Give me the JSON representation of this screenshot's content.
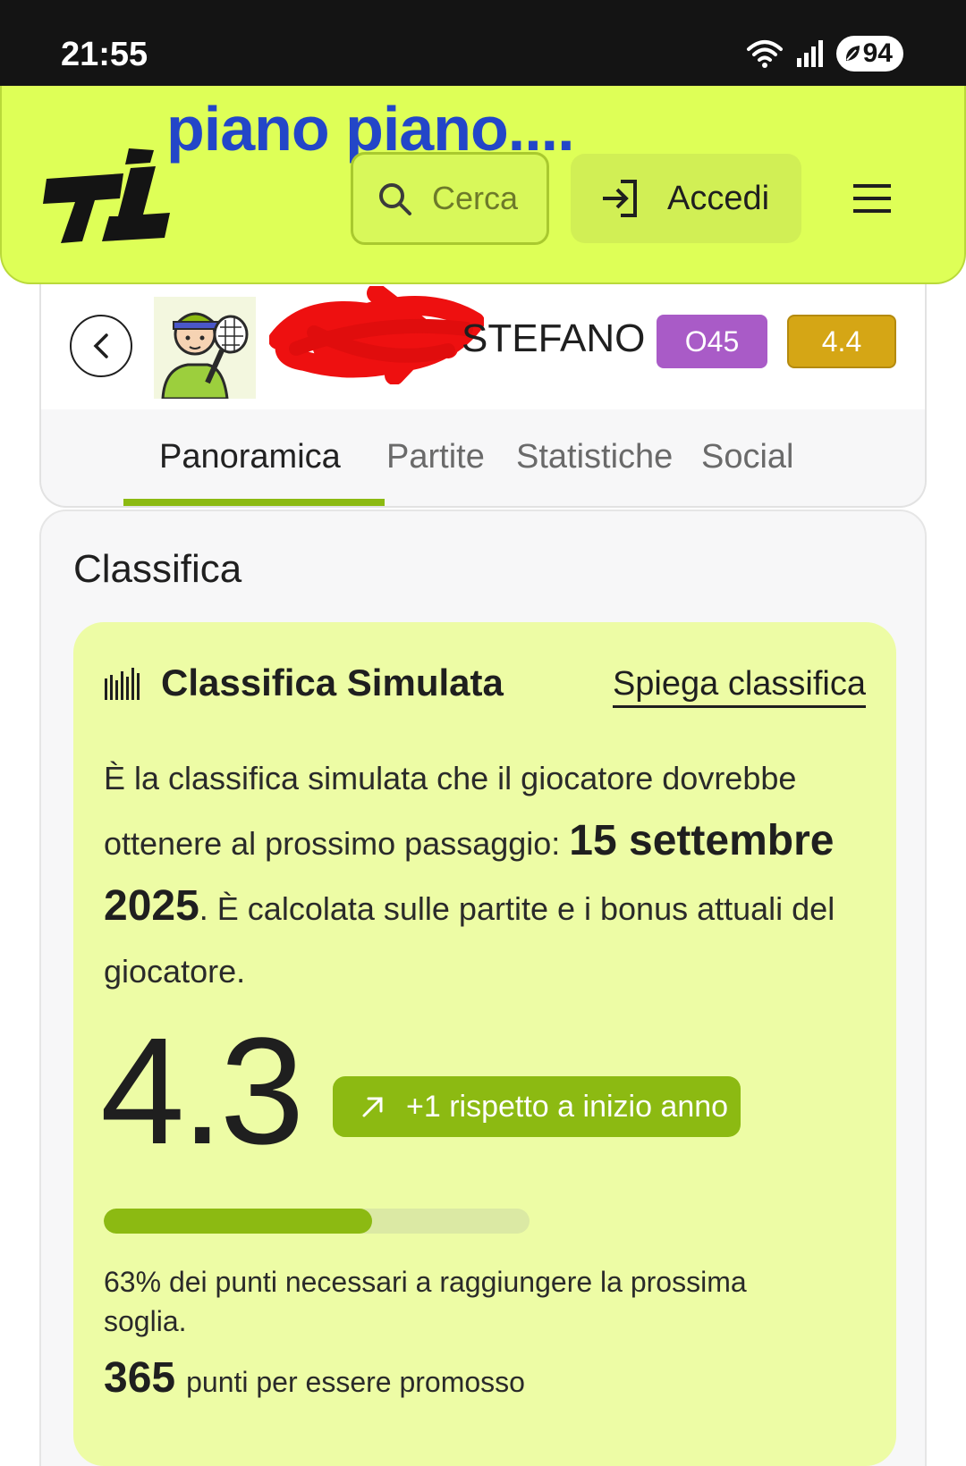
{
  "status_bar": {
    "time": "21:55",
    "battery": "94",
    "icons": [
      "wifi-icon",
      "signal-icon",
      "battery-icon"
    ]
  },
  "annotation": "piano piano....",
  "header": {
    "logo": "TI",
    "search_placeholder": "Cerca",
    "login_label": "Accedi",
    "icons": [
      "search-icon",
      "login-icon",
      "menu-icon"
    ]
  },
  "profile": {
    "name": "STEFANO",
    "category_badge": "O45",
    "ranking_badge": "4.4",
    "tabs": [
      {
        "label": "Panoramica",
        "active": true
      },
      {
        "label": "Partite",
        "active": false
      },
      {
        "label": "Statistiche",
        "active": false
      },
      {
        "label": "Social",
        "active": false
      }
    ]
  },
  "section_title": "Classifica",
  "simulated": {
    "title": "Classifica Simulata",
    "explain_link": "Spiega classifica",
    "desc_before": "È la classifica simulata che il giocatore dovrebbe ottenere al prossimo passaggio: ",
    "desc_date": "15 settembre 2025",
    "desc_after": ". È calcolata sulle partite e i bonus attuali del giocatore.",
    "score": "4.3",
    "delta": "+1 rispetto a inizio anno",
    "progress_fraction": 0.63,
    "progress_text": "63% dei punti necessari a raggiungere la prossima soglia.",
    "points_number": "365",
    "points_text": "punti per essere promosso"
  },
  "colors": {
    "header_bg": "#deff57",
    "accent_green": "#8cba12",
    "card_bg": "#edfca5",
    "category_badge": "#a95bc7",
    "ranking_badge": "#d5a615",
    "annotation_blue": "#2346c8"
  }
}
